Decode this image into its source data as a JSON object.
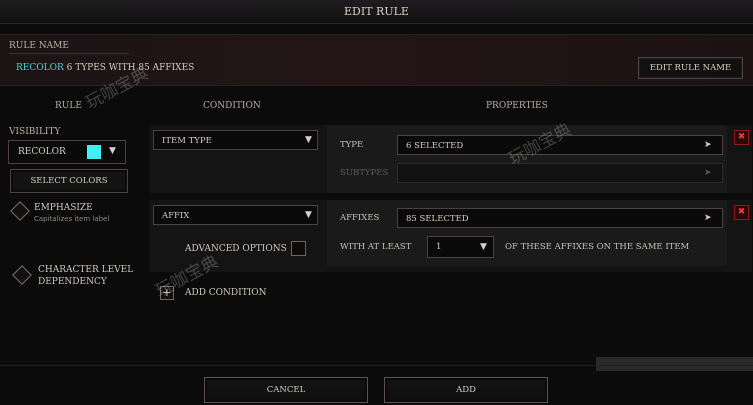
{
  "window": {
    "title": "EDIT RULE"
  },
  "rule_name": {
    "label": "RULE NAME",
    "accent_word": "RECOLOR",
    "rest": "6 TYPES WITH 85 AFFIXES",
    "accent_color": "#4fd4d4",
    "edit_button": "EDIT RULE NAME"
  },
  "columns": {
    "rule": "RULE",
    "condition": "CONDITION",
    "properties": "PROPERTIES"
  },
  "rule_panel": {
    "visibility_label": "VISIBILITY",
    "visibility_value": "RECOLOR",
    "swatch_color": "#3ef0f3",
    "select_colors": "SELECT COLORS",
    "emphasize_label": "EMPHASIZE",
    "emphasize_sub": "Capitalizes item label",
    "char_level_label": "CHARACTER LEVEL DEPENDENCY"
  },
  "conditions": [
    {
      "type": "ITEM TYPE",
      "props": {
        "type_label": "TYPE",
        "type_value": "6 SELECTED",
        "subtypes_label": "SUBTYPES",
        "subtypes_value": ""
      }
    },
    {
      "type": "AFFIX",
      "advanced_options": "ADVANCED OPTIONS",
      "props": {
        "affixes_label": "AFFIXES",
        "affixes_value": "85 SELECTED",
        "atleast_label": "WITH AT LEAST",
        "atleast_value": "1",
        "atleast_suffix": "OF THESE AFFIXES ON THE SAME ITEM"
      }
    }
  ],
  "add_condition": "ADD CONDITION",
  "add_condition_icon": "+",
  "remove_icon": "✖",
  "footer": {
    "cancel": "CANCEL",
    "add": "ADD"
  },
  "watermark": "玩咖宝典"
}
